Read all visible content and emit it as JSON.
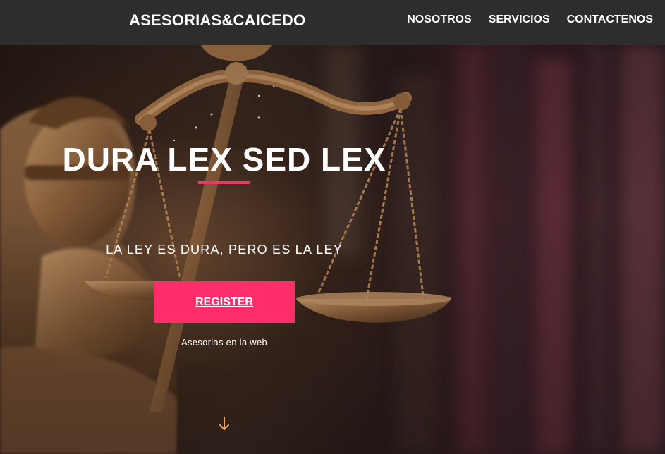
{
  "header": {
    "brand": "ASESORIAS&CAICEDO",
    "nav": [
      {
        "label": "NOSOTROS"
      },
      {
        "label": "SERVICIOS"
      },
      {
        "label": "CONTACTENOS"
      }
    ]
  },
  "hero": {
    "title": "DURA LEX SED LEX",
    "subtitle": "LA LEY ES DURA, PERO ES LA LEY",
    "register_label": "REGISTER",
    "caption": "Asesorias en la web",
    "scroll_icon": "arrow-down-icon",
    "background_icon": "scales-of-justice-statue"
  },
  "colors": {
    "header_bg": "#2d2d2e",
    "accent": "#ff2e6a",
    "scroll_arrow": "#f2a35c",
    "text": "#ffffff"
  }
}
